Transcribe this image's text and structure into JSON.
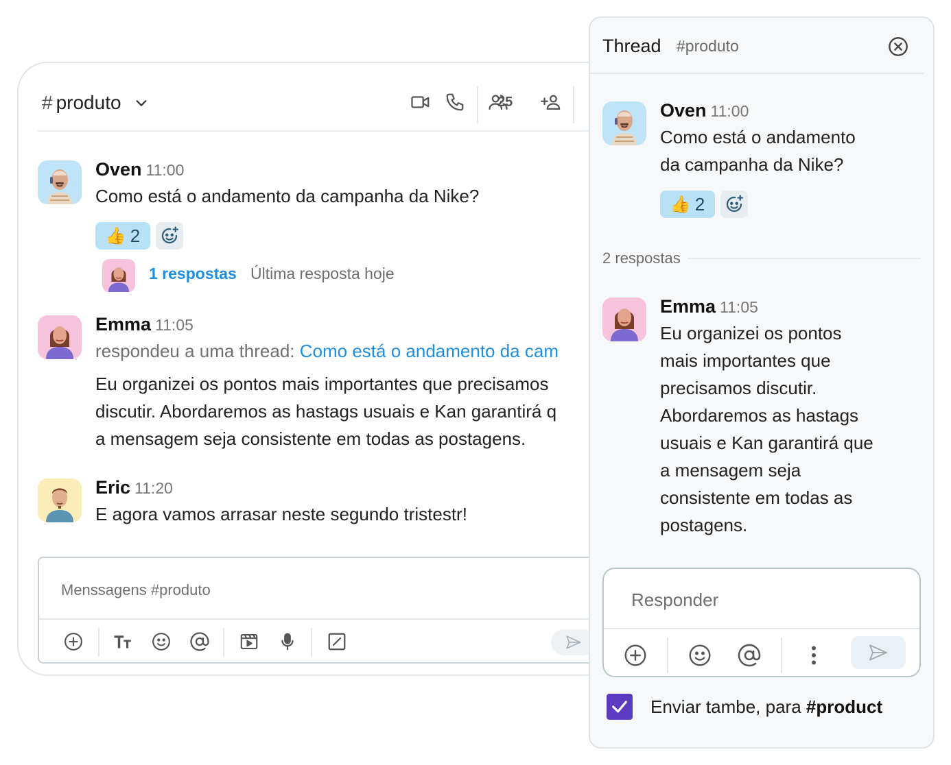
{
  "channel": {
    "hash": "#",
    "name": "produto",
    "member_count": "25"
  },
  "messages": [
    {
      "author": "Oven",
      "time": "11:00",
      "text": "Como está o andamento da campanha da Nike?",
      "reaction_emoji": "👍",
      "reaction_count": "2",
      "replies_link": "1 respostas",
      "last_reply": "Última resposta hoje"
    },
    {
      "author": "Emma",
      "time": "11:05",
      "thread_prefix": "respondeu a uma thread: ",
      "thread_link": "Como está o andamento da cam",
      "text_line1": "Eu organizei os pontos mais importantes que precisamos",
      "text_line2": "discutir. Abordaremos as hastags usuais e Kan garantirá q",
      "text_line3": "a mensagem seja consistente em todas as postagens."
    },
    {
      "author": "Eric",
      "time": "11:20",
      "text": "E agora vamos arrasar neste segundo tristestr!"
    }
  ],
  "composer": {
    "placeholder": "Menssagens #produto"
  },
  "thread": {
    "title": "Thread",
    "channel": "#produto",
    "root": {
      "author": "Oven",
      "time": "11:00",
      "text_line1": "Como está o andamento",
      "text_line2": "da campanha da Nike?",
      "reaction_emoji": "👍",
      "reaction_count": "2"
    },
    "replies_label": "2 respostas",
    "reply": {
      "author": "Emma",
      "time": "11:05",
      "lines": [
        "Eu organizei os pontos",
        "mais importantes que",
        "precisamos discutir.",
        "Abordaremos as hastags",
        "usuais e Kan garantirá que",
        "a mensagem seja",
        "consistente em todas as",
        "postagens."
      ]
    },
    "reply_placeholder": "Responder",
    "also_send_prefix": "Enviar tambe, para ",
    "also_send_channel": "#product",
    "also_send_checked": true
  },
  "colors": {
    "accent_link": "#1f8ee0",
    "reaction_bg": "#b9e1f6",
    "checkbox": "#5b3bbf"
  },
  "icons": [
    "chevron-down-icon",
    "video-icon",
    "phone-icon",
    "members-icon",
    "add-member-icon",
    "pin-icon",
    "plus-circle-icon",
    "text-format-icon",
    "emoji-icon",
    "mention-icon",
    "media-icon",
    "mic-icon",
    "slash-command-icon",
    "send-icon",
    "close-icon",
    "more-icon",
    "add-reaction-icon",
    "check-icon"
  ]
}
